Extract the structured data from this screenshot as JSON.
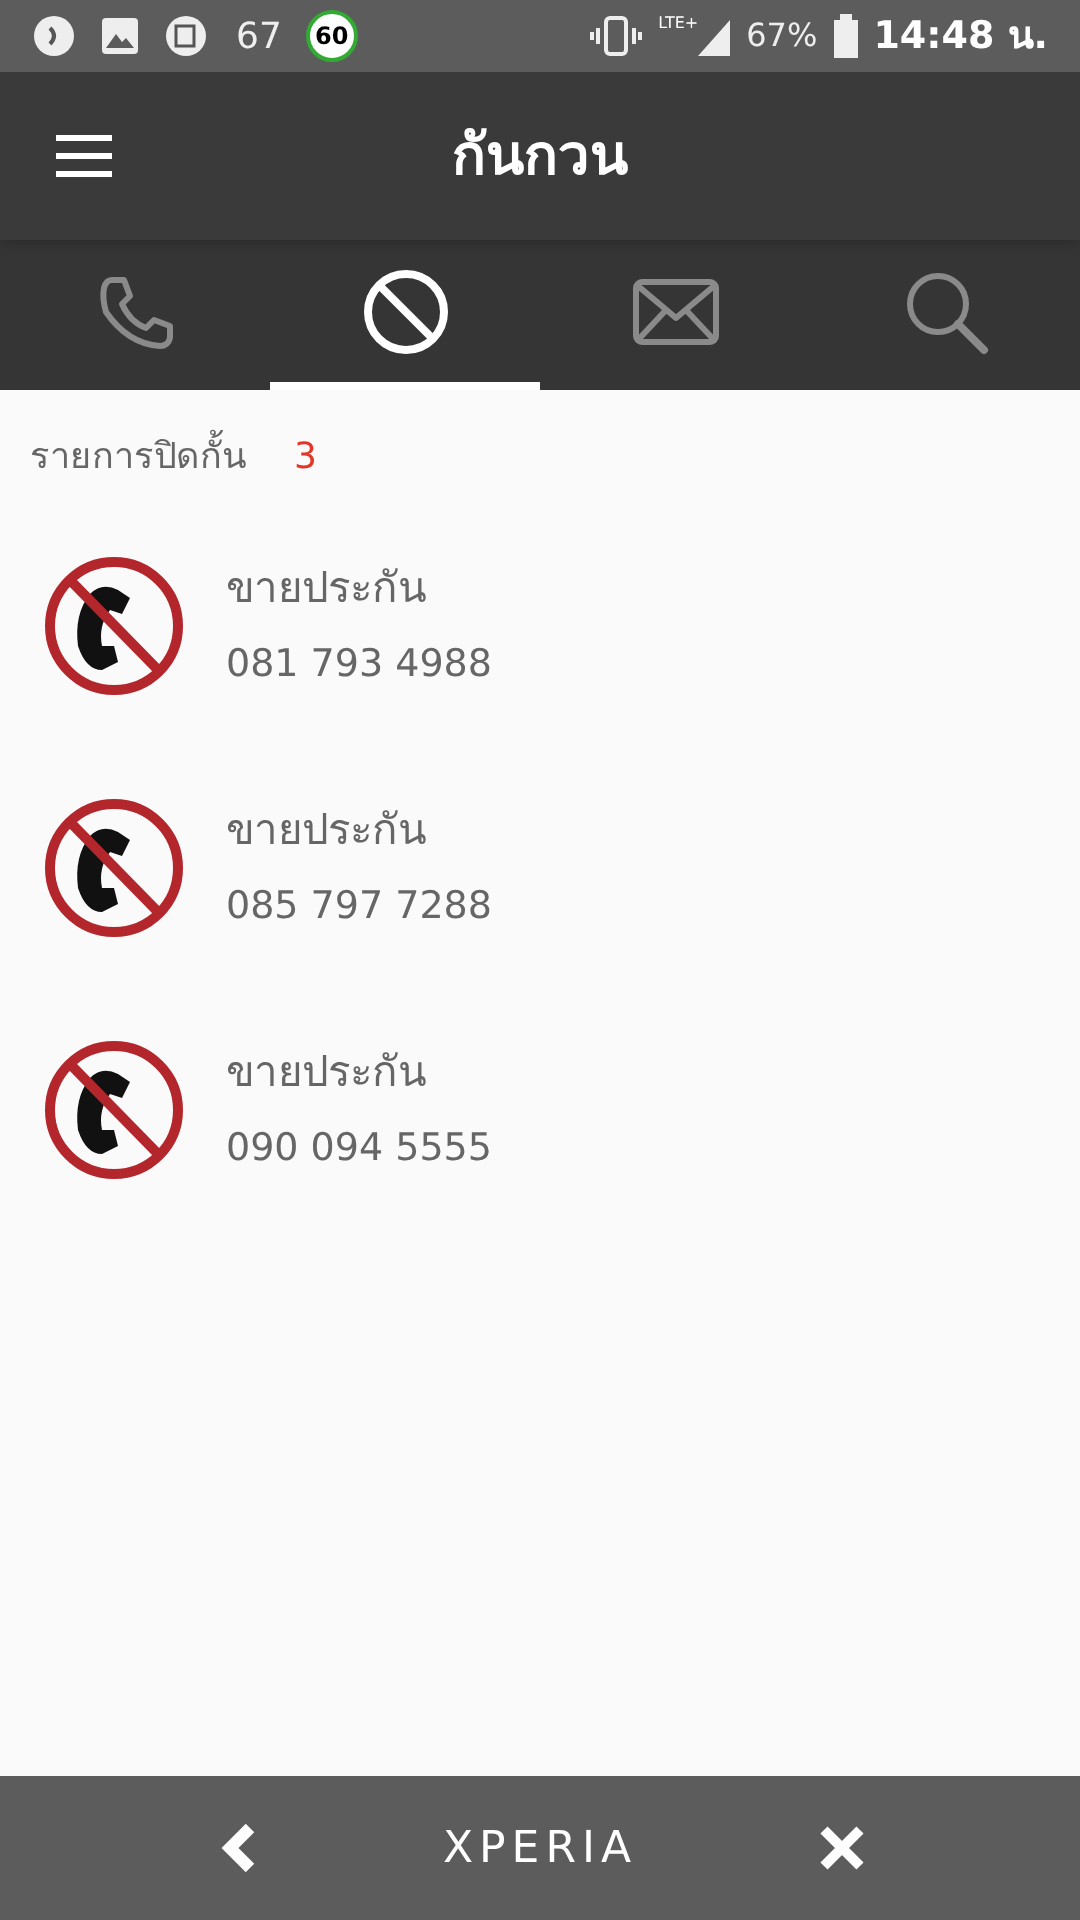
{
  "status_bar": {
    "count": "67",
    "speed_badge": "60",
    "network": "LTE+",
    "battery": "67%",
    "time": "14:48 น."
  },
  "app_bar": {
    "title": "กันกวน"
  },
  "tabs": [
    {
      "kind": "phone",
      "selected": false
    },
    {
      "kind": "block",
      "selected": true
    },
    {
      "kind": "mail",
      "selected": false
    },
    {
      "kind": "search",
      "selected": false
    }
  ],
  "block_list": {
    "label": "รายการปิดกั้น",
    "count": "3"
  },
  "entries": [
    {
      "name": "ขายประกัน",
      "number": "081 793 4988"
    },
    {
      "name": "ขายประกัน",
      "number": "085 797 7288"
    },
    {
      "name": "ขายประกัน",
      "number": "090 094 5555"
    }
  ],
  "nav_bar": {
    "brand": "XPERIA"
  }
}
